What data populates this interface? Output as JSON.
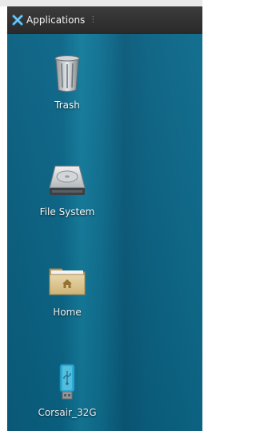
{
  "panel": {
    "apps_label": "Applications",
    "apps_separator": "⋮"
  },
  "desktop": {
    "icons": [
      {
        "label": "Trash",
        "icon": "trash-icon"
      },
      {
        "label": "File System",
        "icon": "hard-drive-icon"
      },
      {
        "label": "Home",
        "icon": "home-folder-icon"
      },
      {
        "label": "Corsair_32G",
        "icon": "usb-drive-icon"
      }
    ]
  },
  "colors": {
    "panel_bg": "#333333",
    "desktop_bg": "#0b6688",
    "accent_blue": "#2a9fd8",
    "folder_tan": "#e6cf98"
  }
}
